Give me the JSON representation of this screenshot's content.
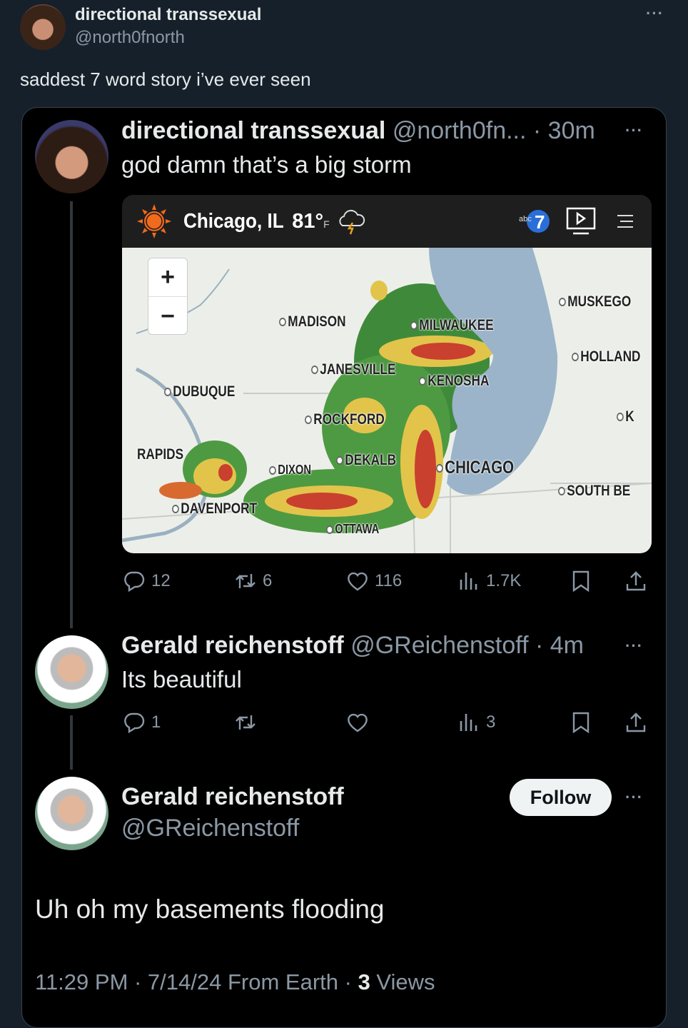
{
  "post": {
    "author_name": "directional transsexual",
    "author_handle": "@north0fnorth",
    "text": "saddest 7 word story i’ve ever seen",
    "more_icon": "more-horizontal-icon"
  },
  "quoted": {
    "tweet1": {
      "author_name": "directional transsexual",
      "author_handle": "@north0fn...",
      "time": "· 30m",
      "text": "god damn that’s a big storm",
      "media": {
        "location": "Chicago, IL",
        "temp": "81°",
        "unit": "F",
        "brand": "abc7",
        "zoom_in": "+",
        "zoom_out": "−",
        "cities": [
          "MADISON",
          "MILWAUKEE",
          "MUSKEGO",
          "HOLLAND",
          "JANESVILLE",
          "KENOSHA",
          "DUBUQUE",
          "ROCKFORD",
          "K",
          "RAPIDS",
          "DEKALB",
          "DIXON",
          "CHICAGO",
          "SOUTH BE",
          "DAVENPORT",
          "OTTAWA"
        ],
        "colors": {
          "lake": "#9bb4c9",
          "radar_green": "#3f8a3a",
          "radar_yellow": "#e2c44a",
          "radar_red": "#c9402e",
          "sun": "#f06a1d"
        }
      },
      "actions": {
        "replies": "12",
        "reposts": "6",
        "likes": "116",
        "views": "1.7K"
      }
    },
    "tweet2": {
      "author_name": "Gerald reichenstoff",
      "author_handle": "@GReichenstoff",
      "time": "· 4m",
      "text": "Its beautiful",
      "actions": {
        "replies": "1",
        "reposts": "",
        "likes": "",
        "views": "3"
      }
    },
    "tweet3": {
      "author_name": "Gerald reichenstoff",
      "author_handle": "@GReichenstoff",
      "follow_label": "Follow",
      "text": "Uh oh my basements flooding",
      "footer_meta": "11:29 PM · 7/14/24 From Earth · ",
      "views_count": "3",
      "views_label": " Views"
    }
  }
}
